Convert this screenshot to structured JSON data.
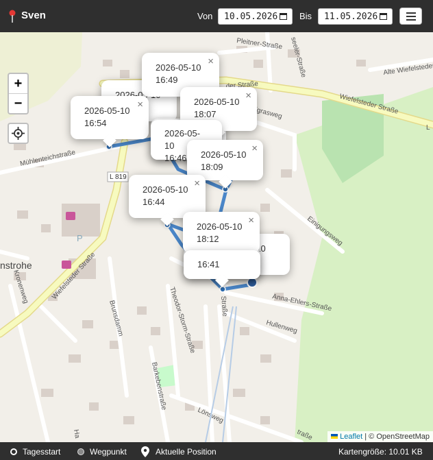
{
  "header": {
    "user_name": "Sven",
    "from_label": "Von",
    "from_date": "10.05.2026",
    "to_label": "Bis",
    "to_date": "11.05.2026",
    "menu_icon": "hamburger-icon"
  },
  "map": {
    "zoom_in": "+",
    "zoom_out": "−",
    "street_labels": {
      "muehlenteich": "Mühlenteichstraße",
      "l819": "L 819",
      "wiefelsteder_diag": "Wiefelsteder Straße",
      "wiefelsteder_top": "der Straße",
      "wiefelsteder_right": "Wiefelsteder Straße",
      "alte_wiefelsteder": "Alte Wiefelsteder",
      "pleitner": "Pleitner-Straße",
      "seeler": "seeler-Straße",
      "grasweg": "llgrasweg",
      "einigungsweg": "Einigungsweg",
      "anna_ehlers": "Anna-Ehlers-Straße",
      "hullenweg": "Hullenweg",
      "brunsdamm": "Brunsdamm",
      "theodor_storm": "Theodor-Storm-Straße",
      "barkeben": "Barkebenstraße",
      "kronenweg": "Kronenweg",
      "rastrohe": "nstrohe",
      "loensweg": "Lönsweg",
      "strasse_bottom": "Straße",
      "l_right": "L",
      "ha": "Ha",
      "strasse_mid": "traße"
    },
    "popups": [
      {
        "date": "2026-05-10",
        "time": "16:49"
      },
      {
        "date": "2026-05-10",
        "time": "18:07"
      },
      {
        "date": "2026-05-10",
        "time": "16:54"
      },
      {
        "date": "2026-05-10",
        "time": "16:46"
      },
      {
        "date": "2026-05-10",
        "time": "18:09"
      },
      {
        "date": "2026-05-10",
        "time": "16:44"
      },
      {
        "date": "2026-05-10",
        "time": "18:12"
      },
      {
        "date": "2026-05-10",
        "time": "16:41"
      }
    ],
    "popup_fragments": {
      "behind_1": "2026-05-10",
      "behind_2": "-10",
      "behind_3": "2026-05-10",
      "behind_4": "2026-05-10"
    },
    "close_glyph": "×",
    "attribution_link": "Leaflet",
    "attribution_text": "| © OpenStreetMap",
    "colors": {
      "track": "#4a86c8",
      "road_major": "#f7fabf",
      "road_minor": "#ffffff",
      "park": "#c8facc"
    }
  },
  "footer": {
    "legend_start": "Tagesstart",
    "legend_waypoint": "Wegpunkt",
    "legend_current": "Aktuelle Position",
    "map_size": "Kartengröße: 10.01 KB"
  }
}
